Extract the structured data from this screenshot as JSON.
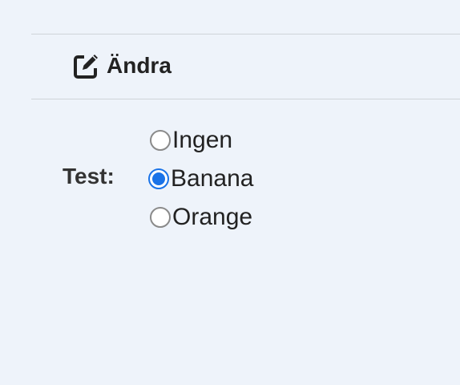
{
  "toolbar": {
    "edit_label": "Ändra",
    "edit_icon": "edit-icon"
  },
  "form": {
    "field_label": "Test:",
    "options": [
      {
        "label": "Ingen",
        "checked": false
      },
      {
        "label": "Banana",
        "checked": true
      },
      {
        "label": "Orange",
        "checked": false
      }
    ],
    "accent_color": "#1a73e8"
  }
}
